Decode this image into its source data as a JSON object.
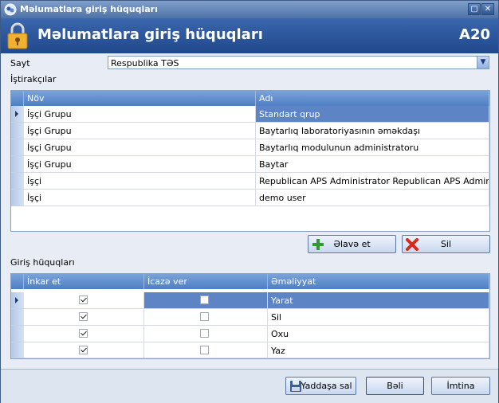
{
  "window": {
    "title": "Məlumatlara giriş hüquqları"
  },
  "header": {
    "title": "Məlumatlara giriş hüquqları",
    "code": "A20"
  },
  "site": {
    "label": "Sayt",
    "value": "Respublika TƏS"
  },
  "participants": {
    "label": "İştirakçılar",
    "columns": [
      "Növ",
      "Adı"
    ],
    "rows": [
      {
        "type": "İşçi Grupu",
        "name": "Standart qrup"
      },
      {
        "type": "İşçi Grupu",
        "name": "Baytarlıq laboratoriyasının əməkdaşı"
      },
      {
        "type": "İşçi Grupu",
        "name": "Baytarlıq modulunun administratoru"
      },
      {
        "type": "İşçi Grupu",
        "name": "Baytar"
      },
      {
        "type": "İşçi",
        "name": "Republican APS Administrator Republican APS Administ..."
      },
      {
        "type": "İşçi",
        "name": "demo user"
      }
    ]
  },
  "buttons": {
    "add": "Əlavə et",
    "delete": "Sil",
    "save": "Yaddaşa sal",
    "ok": "Bəli",
    "cancel": "İmtina"
  },
  "rights": {
    "label": "Giriş hüquqları",
    "columns": [
      "İnkar et",
      "İcazə ver",
      "Əməliyyat"
    ],
    "rows": [
      {
        "deny": true,
        "allow": false,
        "operation": "Yarat"
      },
      {
        "deny": true,
        "allow": false,
        "operation": "Sil"
      },
      {
        "deny": true,
        "allow": false,
        "operation": "Oxu"
      },
      {
        "deny": true,
        "allow": false,
        "operation": "Yaz"
      }
    ]
  },
  "colors": {
    "header": "#2a559b",
    "selection": "#5d84c4",
    "grid_header": "#6490d0"
  }
}
